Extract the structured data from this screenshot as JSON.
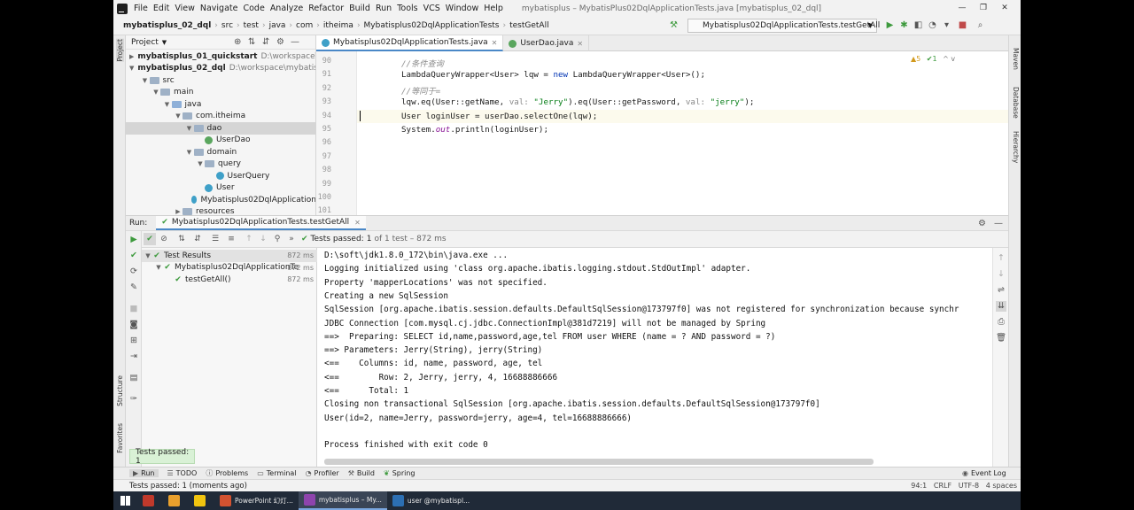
{
  "menu": {
    "items": [
      "File",
      "Edit",
      "View",
      "Navigate",
      "Code",
      "Analyze",
      "Refactor",
      "Build",
      "Run",
      "Tools",
      "VCS",
      "Window",
      "Help"
    ],
    "window_title": "mybatisplus – MybatisPlus02DqlApplicationTests.java [mybatisplus_02_dql]"
  },
  "breadcrumb": [
    "mybatisplus_02_dql",
    "src",
    "test",
    "java",
    "com",
    "itheima",
    "Mybatisplus02DqlApplicationTests",
    "testGetAll"
  ],
  "run_config": "Mybatisplus02DqlApplicationTests.testGetAll",
  "project": {
    "header": "Project",
    "tree": [
      {
        "label": "mybatisplus_01_quickstart",
        "path": "D:\\workspace\\m",
        "kind": "module",
        "depth": 0,
        "arrow": "▶"
      },
      {
        "label": "mybatisplus_02_dql",
        "path": "D:\\workspace\\mybatisp",
        "kind": "module",
        "depth": 0,
        "arrow": "▼"
      },
      {
        "label": "src",
        "path": "",
        "kind": "folder",
        "depth": 1,
        "arrow": "▼"
      },
      {
        "label": "main",
        "path": "",
        "kind": "folder",
        "depth": 2,
        "arrow": "▼"
      },
      {
        "label": "java",
        "path": "",
        "kind": "srcfolder",
        "depth": 3,
        "arrow": "▼"
      },
      {
        "label": "com.itheima",
        "path": "",
        "kind": "folder",
        "depth": 4,
        "arrow": "▼"
      },
      {
        "label": "dao",
        "path": "",
        "kind": "folder",
        "depth": 5,
        "arrow": "▼",
        "selected": true
      },
      {
        "label": "UserDao",
        "path": "",
        "kind": "interface",
        "depth": 6,
        "arrow": ""
      },
      {
        "label": "domain",
        "path": "",
        "kind": "folder",
        "depth": 5,
        "arrow": "▼"
      },
      {
        "label": "query",
        "path": "",
        "kind": "folder",
        "depth": 6,
        "arrow": "▼"
      },
      {
        "label": "UserQuery",
        "path": "",
        "kind": "class",
        "depth": 7,
        "arrow": ""
      },
      {
        "label": "User",
        "path": "",
        "kind": "class",
        "depth": 6,
        "arrow": ""
      },
      {
        "label": "Mybatisplus02DqlApplication",
        "path": "",
        "kind": "class",
        "depth": 5,
        "arrow": ""
      },
      {
        "label": "resources",
        "path": "",
        "kind": "folder",
        "depth": 4,
        "arrow": "▶"
      }
    ]
  },
  "editor": {
    "tabs": [
      {
        "label": "Mybatisplus02DqlApplicationTests.java",
        "active": true
      },
      {
        "label": "UserDao.java",
        "active": false
      }
    ],
    "inspection": {
      "warnings": "5",
      "weak": "1"
    },
    "lines": [
      {
        "num": "90",
        "text": "//条件查询",
        "kind": "comment"
      },
      {
        "num": "91",
        "text": "LambdaQueryWrapper<User> lqw = new LambdaQueryWrapper<User>();",
        "kind": "code"
      },
      {
        "num": "92",
        "text": "//等同于=",
        "kind": "comment"
      },
      {
        "num": "93",
        "text": "lqw.eq(User::getName, val: \"Jerry\").eq(User::getPassword, val: \"jerry\");",
        "kind": "code"
      },
      {
        "num": "94",
        "text": "User loginUser = userDao.selectOne(lqw);",
        "kind": "code",
        "current": true
      },
      {
        "num": "95",
        "text": "System.out.println(loginUser);",
        "kind": "code"
      },
      {
        "num": "96",
        "text": "",
        "kind": "code"
      },
      {
        "num": "97",
        "text": "",
        "kind": "code"
      },
      {
        "num": "98",
        "text": "",
        "kind": "code"
      },
      {
        "num": "99",
        "text": "",
        "kind": "code"
      },
      {
        "num": "100",
        "text": "",
        "kind": "code"
      },
      {
        "num": "101",
        "text": "",
        "kind": "code"
      }
    ]
  },
  "run": {
    "label": "Run:",
    "tab": "Mybatisplus02DqlApplicationTests.testGetAll",
    "status_prefix": "Tests passed:",
    "status_count": "1",
    "status_suffix": "of 1 test – 872 ms",
    "tests": [
      {
        "label": "Test Results",
        "time": "872 ms",
        "depth": 0
      },
      {
        "label": "Mybatisplus02DqlApplicationTe",
        "time": "872 ms",
        "depth": 1
      },
      {
        "label": "testGetAll()",
        "time": "872 ms",
        "depth": 2
      }
    ],
    "console": [
      "D:\\soft\\jdk1.8.0_172\\bin\\java.exe ...",
      "Logging initialized using 'class org.apache.ibatis.logging.stdout.StdOutImpl' adapter.",
      "Property 'mapperLocations' was not specified.",
      "Creating a new SqlSession",
      "SqlSession [org.apache.ibatis.session.defaults.DefaultSqlSession@173797f0] was not registered for synchronization because synchr",
      "JDBC Connection [com.mysql.cj.jdbc.ConnectionImpl@381d7219] will not be managed by Spring",
      "==>  Preparing: SELECT id,name,password,age,tel FROM user WHERE (name = ? AND password = ?)",
      "==> Parameters: Jerry(String), jerry(String)",
      "<==    Columns: id, name, password, age, tel",
      "<==        Row: 2, Jerry, jerry, 4, 16688886666",
      "<==      Total: 1",
      "Closing non transactional SqlSession [org.apache.ibatis.session.defaults.DefaultSqlSession@173797f0]",
      "User(id=2, name=Jerry, password=jerry, age=4, tel=16688886666)",
      "",
      "Process finished with exit code 0"
    ]
  },
  "badge": "Tests passed: 1",
  "left_strip": [
    "Project",
    "Structure",
    "Favorites"
  ],
  "right_strip": [
    "Maven",
    "Database",
    "Hierarchy"
  ],
  "bottom_tools": [
    "Run",
    "TODO",
    "Problems",
    "Terminal",
    "Profiler",
    "Build",
    "Spring"
  ],
  "event_log": "Event Log",
  "statusbar": {
    "text": "Tests passed: 1 (moments ago)",
    "position": "94:1",
    "line_sep": "CRLF",
    "encoding": "UTF-8",
    "indent": "4 spaces"
  },
  "taskbar": [
    {
      "label": "",
      "color": "#c0392b"
    },
    {
      "label": "",
      "color": "#e9a02d"
    },
    {
      "label": "",
      "color": "#f1c40f"
    },
    {
      "label": "PowerPoint 幻灯...",
      "color": "#d35230",
      "active": false
    },
    {
      "label": "mybatisplus – My...",
      "color": "#8e44ad",
      "active": true
    },
    {
      "label": "user @mybatispl...",
      "color": "#2c6fb3",
      "active": false
    }
  ]
}
